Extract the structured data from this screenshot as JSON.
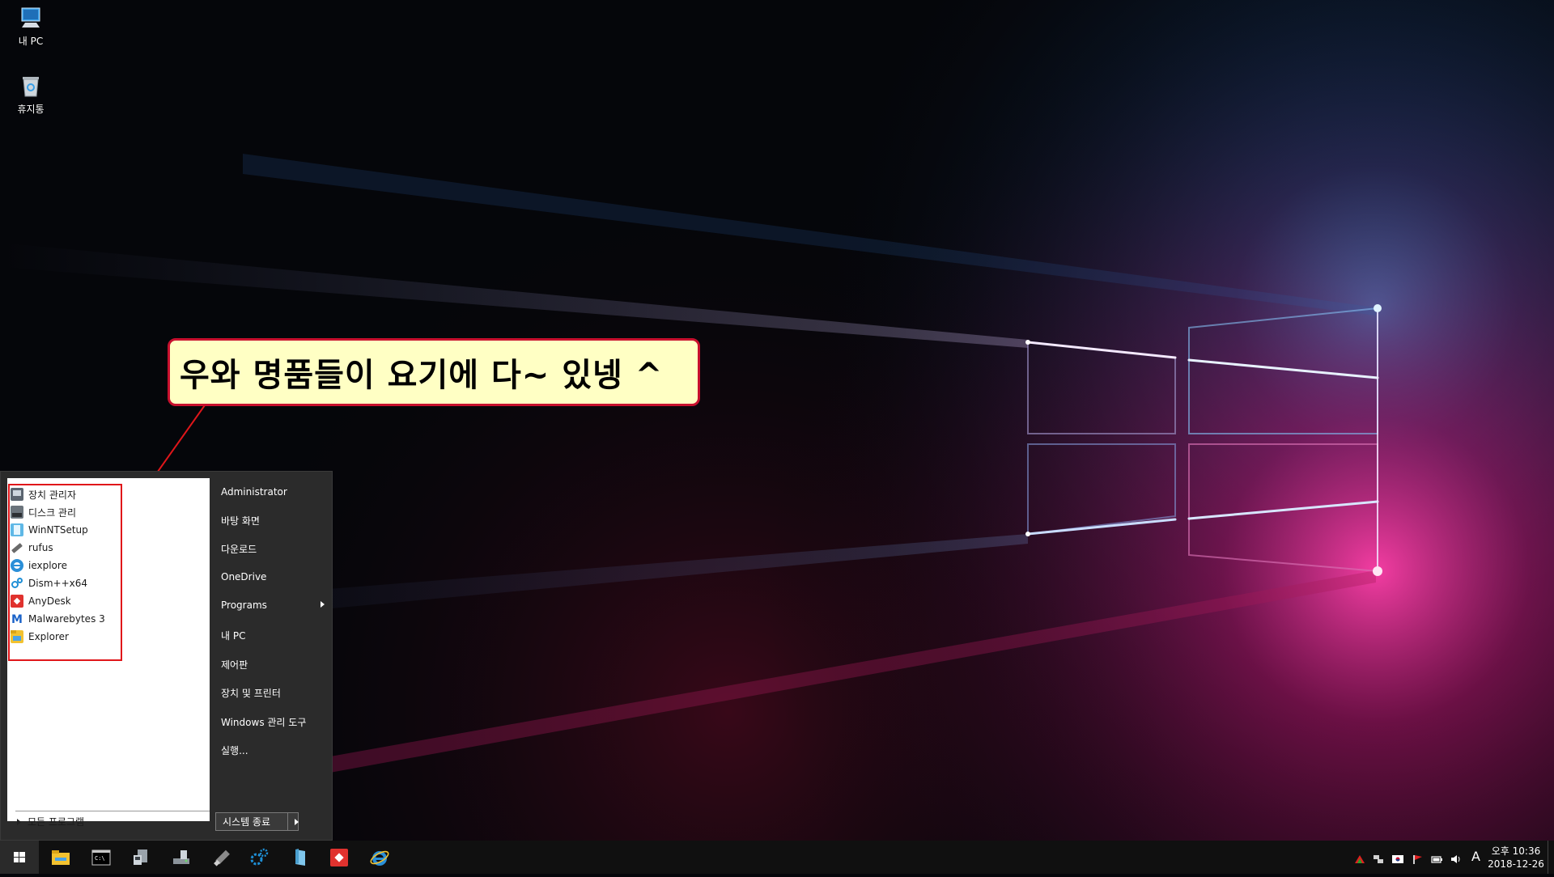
{
  "desktop": {
    "icons": [
      {
        "label": "내 PC",
        "icon": "computer-icon"
      },
      {
        "label": "휴지통",
        "icon": "recycle-bin-icon"
      }
    ]
  },
  "callout": {
    "text": "우와 명품들이 요기에 다~ 있넹 ^",
    "background": "#ffffc4",
    "border_color": "#c8102e",
    "arrow_color": "#e0161a"
  },
  "start_menu": {
    "pinned": [
      {
        "label": "장치 관리자",
        "icon": "device-manager-icon"
      },
      {
        "label": "디스크 관리",
        "icon": "disk-management-icon"
      },
      {
        "label": "WinNTSetup",
        "icon": "winntsetup-icon"
      },
      {
        "label": "rufus",
        "icon": "usb-drive-icon"
      },
      {
        "label": "iexplore",
        "icon": "internet-explorer-icon"
      },
      {
        "label": "Dism++x64",
        "icon": "dism-gears-icon"
      },
      {
        "label": "AnyDesk",
        "icon": "anydesk-icon"
      },
      {
        "label": "Malwarebytes 3",
        "icon": "malwarebytes-icon"
      },
      {
        "label": "Explorer",
        "icon": "explorer-folder-icon"
      }
    ],
    "all_programs": "모든 프로그램",
    "right_items": [
      {
        "label": "Administrator"
      },
      {
        "label": "바탕 화면"
      },
      {
        "label": "다운로드"
      },
      {
        "label": "OneDrive"
      },
      {
        "label": "Programs"
      },
      {
        "label": "내 PC"
      },
      {
        "label": "제어판"
      },
      {
        "label": "장치 및 프린터"
      },
      {
        "label": "Windows 관리 도구"
      },
      {
        "label": "실행..."
      }
    ],
    "shutdown": "시스템 종료"
  },
  "taskbar": {
    "apps": [
      "file-explorer-icon",
      "command-prompt-icon",
      "device-manager-icon",
      "disk-management-icon",
      "usb-drive-icon",
      "dism-gears-icon",
      "winntsetup-icon",
      "anydesk-icon",
      "internet-explorer-icon"
    ],
    "ime": "A",
    "clock": {
      "time": "오후 10:36",
      "date": "2018-12-26"
    }
  }
}
